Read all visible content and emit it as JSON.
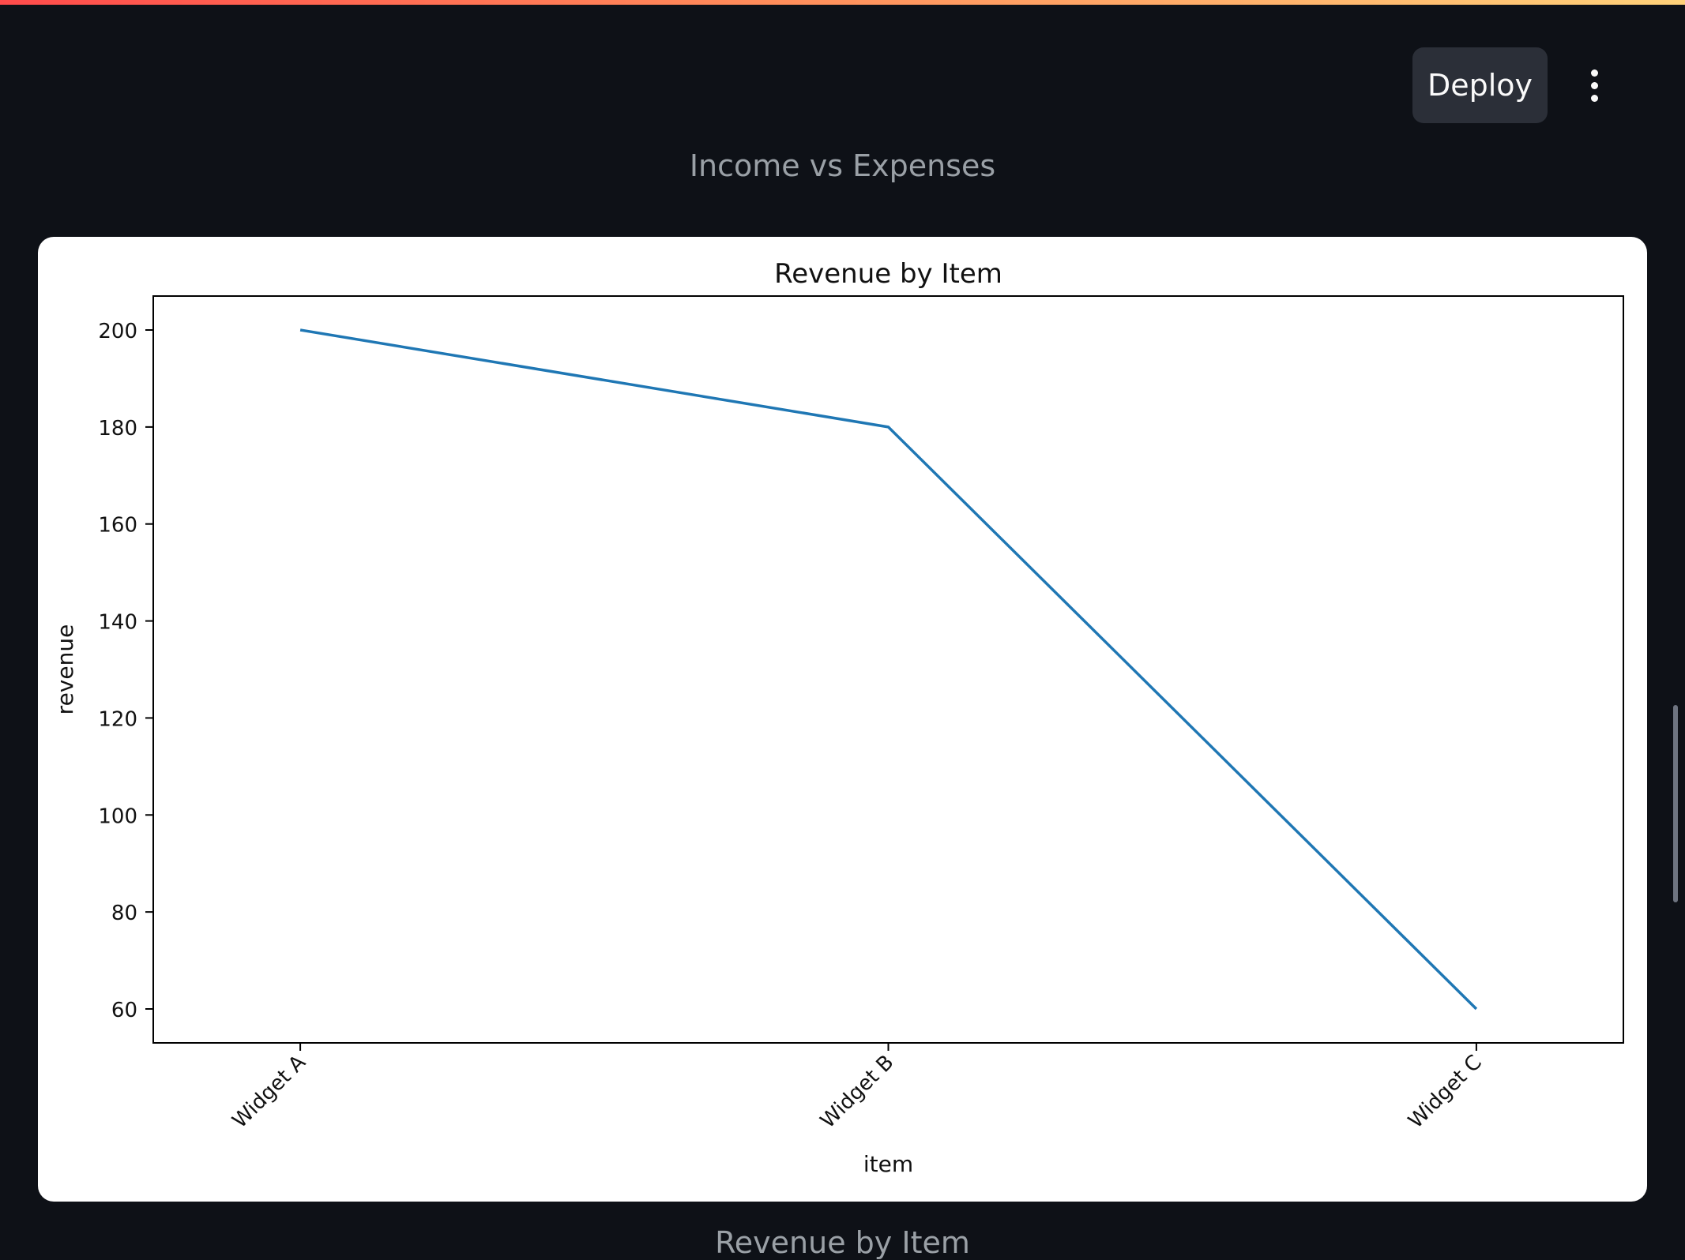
{
  "header": {
    "deploy_label": "Deploy",
    "menu_icon": "kebab-menu-icon"
  },
  "captions": {
    "above_chart": "Income vs Expenses",
    "below_chart": "Revenue by Item"
  },
  "colors": {
    "page_background": "#0e1117",
    "line": "#1f77b4"
  },
  "chart_data": {
    "type": "line",
    "title": "Revenue by Item",
    "xlabel": "item",
    "ylabel": "revenue",
    "categories": [
      "Widget A",
      "Widget B",
      "Widget C"
    ],
    "values": [
      200,
      180,
      60
    ],
    "ylim": [
      53,
      207
    ],
    "yticks": [
      60,
      80,
      100,
      120,
      140,
      160,
      180,
      200
    ],
    "grid": false,
    "legend": "none"
  }
}
